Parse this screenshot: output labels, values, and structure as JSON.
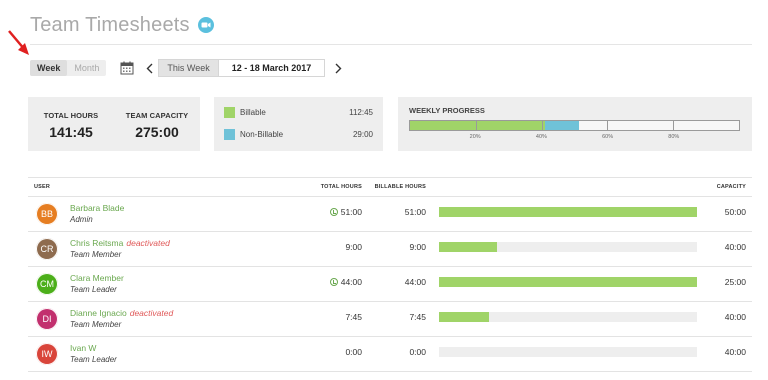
{
  "header": {
    "title": "Team Timesheets",
    "icon": "video-camera-icon"
  },
  "toolbar": {
    "week_label": "Week",
    "month_label": "Month",
    "this_week_label": "This Week",
    "date_range": "12 - 18 March 2017"
  },
  "summary": {
    "total_hours_label": "TOTAL HOURS",
    "total_hours": "141:45",
    "capacity_label": "TEAM CAPACITY",
    "capacity": "275:00",
    "billable_label": "Billable",
    "billable": "112:45",
    "non_billable_label": "Non-Billable",
    "non_billable": "29:00"
  },
  "weekly_progress": {
    "label": "WEEKLY PROGRESS",
    "ticks": [
      "20%",
      "40%",
      "60%",
      "80%"
    ],
    "billable_fraction": 0.41,
    "non_billable_fraction": 0.105
  },
  "colors": {
    "billable": "#a0d468",
    "non_billable": "#6fc2d8",
    "user_name": "#6aa84f",
    "deactivated": "#e05a5a"
  },
  "table": {
    "headers": {
      "user": "USER",
      "total": "TOTAL HOURS",
      "billable": "BILLABLE HOURS",
      "capacity": "CAPACITY"
    },
    "rows": [
      {
        "initials": "BB",
        "avatar_color": "#e67e22",
        "name": "Barbara Blade",
        "status": "",
        "role": "Admin",
        "total": "51:00",
        "clock": true,
        "billable": "51:00",
        "fill": 1.0,
        "capacity": "50:00"
      },
      {
        "initials": "CR",
        "avatar_color": "#8e6b4e",
        "name": "Chris Reitsma",
        "status": "deactivated",
        "role": "Team Member",
        "total": "9:00",
        "clock": false,
        "billable": "9:00",
        "fill": 0.225,
        "capacity": "40:00"
      },
      {
        "initials": "CM",
        "avatar_color": "#4caf1a",
        "name": "Clara Member",
        "status": "",
        "role": "Team Leader",
        "total": "44:00",
        "clock": true,
        "billable": "44:00",
        "fill": 1.0,
        "capacity": "25:00"
      },
      {
        "initials": "DI",
        "avatar_color": "#c2306e",
        "name": "Dianne Ignacio",
        "status": "deactivated",
        "role": "Team Member",
        "total": "7:45",
        "clock": false,
        "billable": "7:45",
        "fill": 0.194,
        "capacity": "40:00"
      },
      {
        "initials": "IW",
        "avatar_color": "#d9453b",
        "name": "Ivan W",
        "status": "",
        "role": "Team Leader",
        "total": "0:00",
        "clock": false,
        "billable": "0:00",
        "fill": 0.0,
        "capacity": "40:00"
      }
    ]
  }
}
